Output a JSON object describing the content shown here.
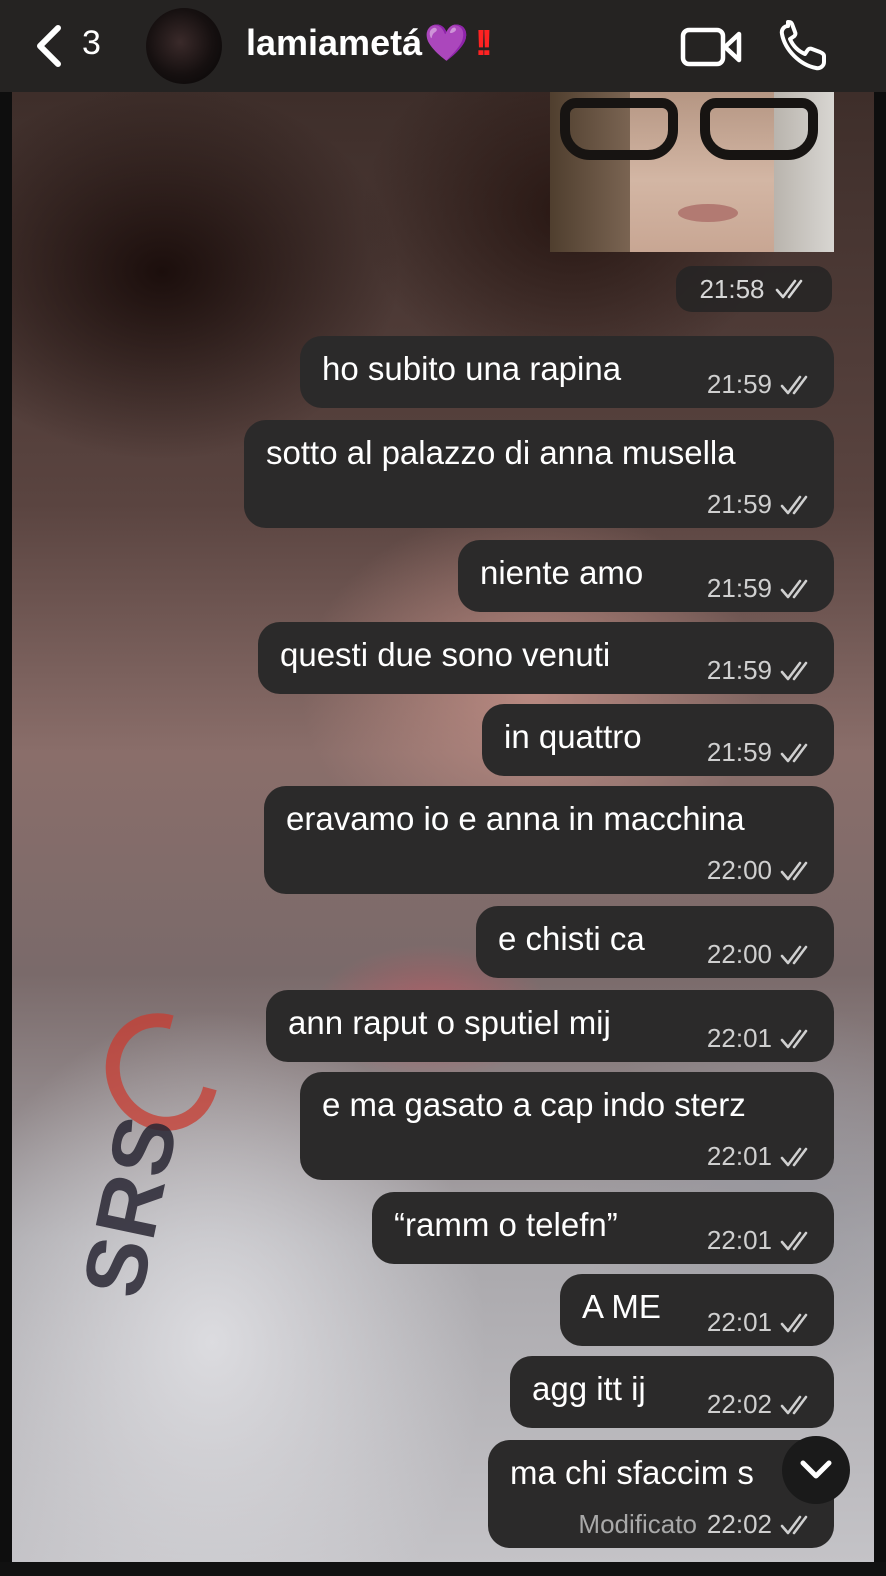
{
  "header": {
    "back_count": "3",
    "contact_name": "lamiametá",
    "contact_emoji_heart": "💜",
    "contact_emoji_bang": "!!",
    "video_icon": "video-camera-icon",
    "call_icon": "phone-icon"
  },
  "photo_message": {
    "time": "21:58"
  },
  "messages": [
    {
      "text": "ho subito una rapina",
      "time": "21:59"
    },
    {
      "text": "sotto al palazzo di anna musella",
      "time": "21:59"
    },
    {
      "text": "niente amo",
      "time": "21:59"
    },
    {
      "text": "questi due sono venuti",
      "time": "21:59"
    },
    {
      "text": "in quattro",
      "time": "21:59"
    },
    {
      "text": "eravamo io e anna in macchina",
      "time": "22:00"
    },
    {
      "text": "e chisti ca",
      "time": "22:00"
    },
    {
      "text": "ann raput o sputiel mij",
      "time": "22:01"
    },
    {
      "text": "e ma gasato a cap indo sterz",
      "time": "22:01"
    },
    {
      "text": "“ramm o telefn”",
      "time": "22:01"
    },
    {
      "text": "A ME",
      "time": "22:01"
    },
    {
      "text": "agg itt ij",
      "time": "22:02"
    },
    {
      "text": "ma chi sfaccim s",
      "time": "22:02",
      "edited": "Modificato"
    }
  ],
  "scroll_button": "chevron-down-icon",
  "wallpaper_logo_text": "SRS"
}
